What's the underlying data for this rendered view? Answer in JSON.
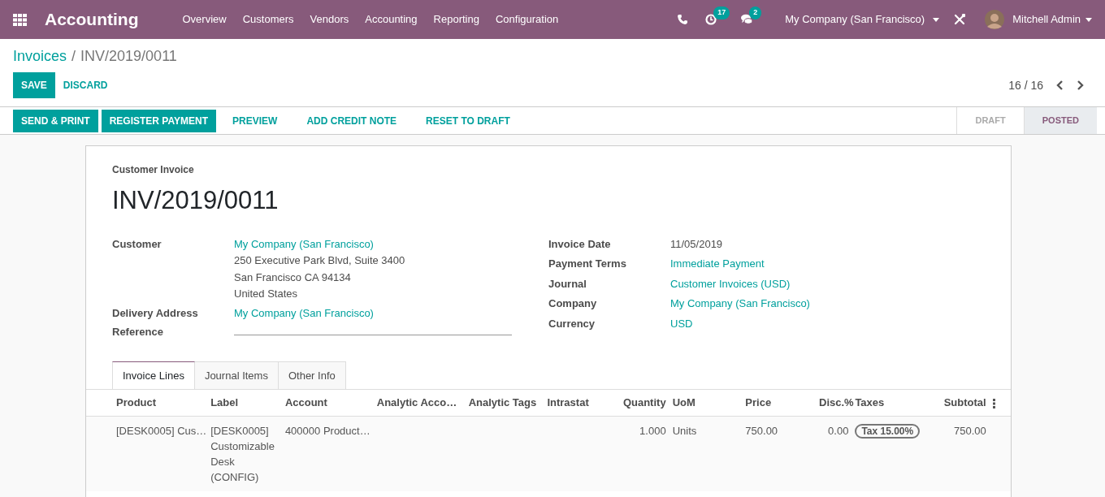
{
  "navbar": {
    "app_name": "Accounting",
    "menu": [
      "Overview",
      "Customers",
      "Vendors",
      "Accounting",
      "Reporting",
      "Configuration"
    ],
    "activity_count": "17",
    "message_count": "2",
    "company": "My Company (San Francisco)",
    "user": "Mitchell Admin"
  },
  "breadcrumb": {
    "parent": "Invoices",
    "separator": "/",
    "current": "INV/2019/0011"
  },
  "form_buttons": [
    "SAVE",
    "DISCARD"
  ],
  "pager": "16 / 16",
  "actions": [
    {
      "label": "SEND & PRINT",
      "primary": true
    },
    {
      "label": "REGISTER PAYMENT",
      "primary": true
    },
    {
      "label": "PREVIEW",
      "primary": false
    },
    {
      "label": "ADD CREDIT NOTE",
      "primary": false
    },
    {
      "label": "RESET TO DRAFT",
      "primary": false
    }
  ],
  "status_steps": [
    {
      "label": "DRAFT",
      "selected": false
    },
    {
      "label": "POSTED",
      "selected": true
    }
  ],
  "sheet": {
    "type_label": "Customer Invoice",
    "number": "INV/2019/0011",
    "left_fields": [
      {
        "label": "Customer",
        "value": "My Company (San Francisco)",
        "address": [
          "250 Executive Park Blvd, Suite 3400",
          "San Francisco CA 94134",
          "United States"
        ]
      },
      {
        "label": "Delivery Address",
        "value": "My Company (San Francisco)"
      },
      {
        "label": "Reference",
        "kind": "input"
      }
    ],
    "right_fields": [
      {
        "label": "Invoice Date",
        "value": "11/05/2019",
        "kind": "text"
      },
      {
        "label": "Payment Terms",
        "value": "Immediate Payment",
        "kind": "link"
      },
      {
        "label": "Journal",
        "value": "Customer Invoices (USD)",
        "kind": "link"
      },
      {
        "label": "Company",
        "value": "My Company (San Francisco)",
        "kind": "link"
      },
      {
        "label": "Currency",
        "value": "USD",
        "kind": "link"
      }
    ],
    "tabs": [
      {
        "label": "Invoice Lines",
        "selected": true
      },
      {
        "label": "Journal Items",
        "selected": false
      },
      {
        "label": "Other Info",
        "selected": false
      }
    ],
    "table": {
      "columns": [
        "Product",
        "Label",
        "Account",
        "Analytic Acco…",
        "Analytic Tags",
        "Intrastat",
        "Quantity",
        "UoM",
        "Price",
        "Disc.%",
        "Taxes",
        "Subtotal"
      ],
      "rows": [
        {
          "product": "[DESK0005] Cus…",
          "label": "[DESK0005] Customizable Desk (CONFIG)",
          "account": "400000 Product…",
          "quantity": "1.000",
          "uom": "Units",
          "price": "750.00",
          "discount": "0.00",
          "taxes": [
            "Tax 15.00%"
          ],
          "subtotal": "750.00"
        }
      ]
    }
  }
}
